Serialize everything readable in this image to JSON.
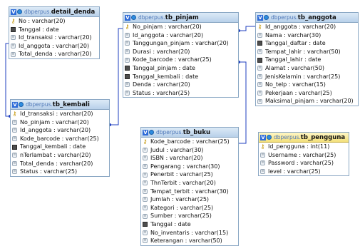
{
  "schema": "dbperpus",
  "tables": {
    "detail_denda": {
      "name": "detail_denda",
      "fields": [
        {
          "text": "No : varchar(20)",
          "kind": "key"
        },
        {
          "text": "Tanggal : date",
          "kind": "date"
        },
        {
          "text": "Id_transaksi : varchar(20)",
          "kind": "field"
        },
        {
          "text": "Id_anggota : varchar(20)",
          "kind": "field"
        },
        {
          "text": "Total_denda : varchar(20)",
          "kind": "field"
        }
      ]
    },
    "tb_pinjam": {
      "name": "tb_pinjam",
      "fields": [
        {
          "text": "No_pinjam : varchar(20)",
          "kind": "key"
        },
        {
          "text": "Id_anggota : varchar(20)",
          "kind": "field"
        },
        {
          "text": "Tanggungan_pinjam : varchar(20)",
          "kind": "field"
        },
        {
          "text": "Durasi : varchar(20)",
          "kind": "field"
        },
        {
          "text": "Kode_barcode : varchar(25)",
          "kind": "field"
        },
        {
          "text": "Tanggal_pinjam : date",
          "kind": "date"
        },
        {
          "text": "Tanggal_kembali : date",
          "kind": "date"
        },
        {
          "text": "Denda : varchar(20)",
          "kind": "field"
        },
        {
          "text": "Status : varchar(25)",
          "kind": "field"
        }
      ]
    },
    "tb_anggota": {
      "name": "tb_anggota",
      "fields": [
        {
          "text": "Id_anggota : varchar(20)",
          "kind": "key"
        },
        {
          "text": "Nama : varchar(30)",
          "kind": "field"
        },
        {
          "text": "Tanggal_daftar : date",
          "kind": "date"
        },
        {
          "text": "Tempat_lahir : varchar(50)",
          "kind": "field"
        },
        {
          "text": "Tanggal_lahir : date",
          "kind": "date"
        },
        {
          "text": "Alamat : varchar(50)",
          "kind": "field"
        },
        {
          "text": "JenisKelamin : varchar(25)",
          "kind": "field"
        },
        {
          "text": "No_telp : varchar(15)",
          "kind": "field"
        },
        {
          "text": "Pekerjaan : varchar(25)",
          "kind": "field"
        },
        {
          "text": "Maksimal_pinjam : varchar(20)",
          "kind": "field"
        }
      ]
    },
    "tb_kembali": {
      "name": "tb_kembali",
      "fields": [
        {
          "text": "Id_transaksi : varchar(20)",
          "kind": "key"
        },
        {
          "text": "No_pinjam : varchar(20)",
          "kind": "field"
        },
        {
          "text": "Id_anggota : varchar(20)",
          "kind": "field"
        },
        {
          "text": "Kode_barcode : varchar(25)",
          "kind": "field"
        },
        {
          "text": "Tanggal_kembali : date",
          "kind": "date"
        },
        {
          "text": "nTerlambat : varchar(20)",
          "kind": "field"
        },
        {
          "text": "Total_denda : varchar(20)",
          "kind": "field"
        },
        {
          "text": "Status : varchar(25)",
          "kind": "field"
        }
      ]
    },
    "tb_buku": {
      "name": "tb_buku",
      "fields": [
        {
          "text": "Kode_barcode : varchar(25)",
          "kind": "key"
        },
        {
          "text": "Judul : varchar(30)",
          "kind": "field"
        },
        {
          "text": "ISBN : varchar(20)",
          "kind": "field"
        },
        {
          "text": "Pengarang : varchar(30)",
          "kind": "field"
        },
        {
          "text": "Penerbit : varchar(25)",
          "kind": "field"
        },
        {
          "text": "ThnTerbit : varchar(20)",
          "kind": "field"
        },
        {
          "text": "Tempat_terbit : varchar(30)",
          "kind": "field"
        },
        {
          "text": "Jumlah : varchar(25)",
          "kind": "field"
        },
        {
          "text": "Kategori : varchar(25)",
          "kind": "field"
        },
        {
          "text": "Sumber : varchar(25)",
          "kind": "field"
        },
        {
          "text": "Tanggal : date",
          "kind": "date"
        },
        {
          "text": "No_inventaris : varchar(15)",
          "kind": "field"
        },
        {
          "text": "Keterangan : varchar(50)",
          "kind": "field"
        }
      ]
    },
    "tb_pengguna": {
      "name": "tb_pengguna",
      "fields": [
        {
          "text": "Id_pengguna : int(11)",
          "kind": "key"
        },
        {
          "text": "Username : varchar(25)",
          "kind": "field"
        },
        {
          "text": "Password : varchar(25)",
          "kind": "field"
        },
        {
          "text": "level : varchar(25)",
          "kind": "field"
        }
      ]
    }
  },
  "colors": {
    "header": "#c6dbf0",
    "header_highlight": "#f3df7a",
    "line": "#1f3fbf",
    "key": "#c29400"
  }
}
